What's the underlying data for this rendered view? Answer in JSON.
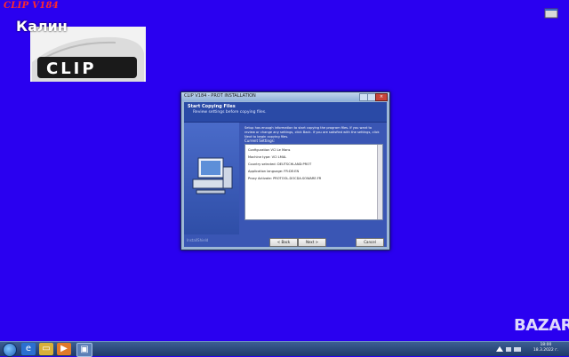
{
  "desktop": {
    "top_title": "CLIP V184",
    "user_name": "Калин",
    "logo_text": "CLIP",
    "watermark": "BAZAR"
  },
  "dialog": {
    "title": "CLIP V184 - PROT INSTALLATION",
    "header_title": "Start Copying Files",
    "header_subtitle": "Review settings before copying files.",
    "intro_text": "Setup has enough information to start copying the program files. If you want to review or change any settings, click Back. If you are satisfied with the settings, click Next to begin copying files.",
    "group_label": "Current Settings:",
    "settings": [
      "Configuration VCI Le Mans",
      "Machine type: VCI LMAL",
      "Country selected: DEUTSCHLAND:PROT",
      "Application language: FR:DE:EN",
      "Proxy Activate: PROTOOL.DOCDA.SOWARE.FR"
    ],
    "brand": "InstallShield",
    "buttons": {
      "back": "< Back",
      "next": "Next >",
      "cancel": "Cancel"
    },
    "accent": "#2a4aa6"
  },
  "taskbar": {
    "time": "18:00",
    "date": "18.3.2022 г."
  },
  "colors": {
    "desktop_bg": "#2a00f0",
    "title_red": "#ff2a2a"
  }
}
